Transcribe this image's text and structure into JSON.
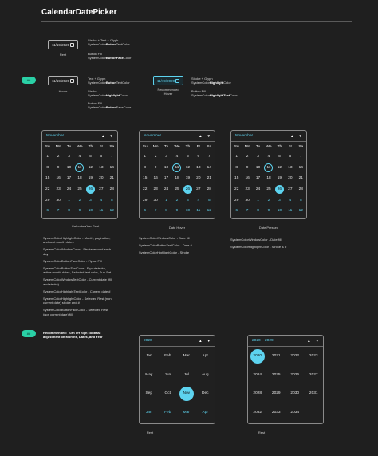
{
  "page_title": "CalendarDatePicker",
  "rest": {
    "date": "11/19/2020",
    "caption": "Rest",
    "desc1a": "Stroke + Text + Glyph",
    "desc1b": "SystemColor",
    "desc1bold": "Button",
    "desc1c": "TextColor",
    "desc2a": "Button Fill",
    "desc2b": "SystemColor",
    "desc2bold": "ButtonFace",
    "desc2c": "Color"
  },
  "hover": {
    "badge": "##",
    "date": "11/19/2020",
    "caption": "Hover",
    "desc1a": "Text + Glyph",
    "desc1b": "SystemColor",
    "desc1bold": "Button",
    "desc1c": "TextColor",
    "desc2a": "Stroke",
    "desc2b": "SystemColor",
    "desc2bold": "Highlight",
    "desc2c": "Color",
    "desc3a": "Button Fill",
    "desc3b": "SystemColor",
    "desc3bold": "Button",
    "desc3c": "FaceColor"
  },
  "rec_hover": {
    "date": "11/19/2020",
    "caption1": "Recommended",
    "caption2": "Hover",
    "desc1a": "Stroke + Glyph",
    "desc1b": "SystemColor",
    "desc1bold": "Highlight",
    "desc1c": "Color",
    "desc2a": "Button Fill",
    "desc2b": "SystemColor",
    "desc2bold": "HighlightText",
    "desc2c": "Color"
  },
  "calendar": {
    "month": "November",
    "up": "▲",
    "down": "▼",
    "weekdays": [
      "Su",
      "Mo",
      "Tu",
      "We",
      "Th",
      "Fr",
      "Sa"
    ],
    "days": [
      "1",
      "2",
      "3",
      "4",
      "5",
      "6",
      "7",
      "8",
      "9",
      "10",
      "11",
      "12",
      "13",
      "14",
      "15",
      "16",
      "17",
      "18",
      "19",
      "20",
      "21",
      "22",
      "23",
      "24",
      "25",
      "26",
      "27",
      "28",
      "29",
      "30",
      "1",
      "2",
      "3",
      "4",
      "5",
      "6",
      "7",
      "8",
      "9",
      "10",
      "11",
      "12"
    ]
  },
  "cal_captions": {
    "rest": "CalendarView Rest",
    "hover": "Date Hover",
    "pressed": "Date Pressed"
  },
  "notes_rest": [
    "SystemColorHighlightColor - Month, pagination, and next month dates",
    "SystemColorWindowColor - Stroke around each day",
    "SystemColorButtonFaceColor - Flyout Fill",
    "SystemColorButtonTextColor - Flyout stroke, active month dates, Selected text color, Sun-Sat",
    "SystemColorWindowTextColor - Current date (fill and stroke)",
    "SystemColorHighlightTextColor - Current date #",
    "SystemColorHighlightColor - Selected Rest (non current date) stroke and #",
    "SystemColorButtonFaceColor - Selected Rest (non current date) fill"
  ],
  "notes_hover": [
    "SystemColorWindowColor - Date fill",
    "SystemColorButtonTextColor - Date #",
    "SystemColorHighlightColor - Stroke"
  ],
  "notes_pressed": [
    "SystemColorWindowColor - Date fill",
    "SystemColorHighlightColor - Stroke & #"
  ],
  "recommend": {
    "badge": "##",
    "text1": "Recommended: Turn off high contrast",
    "text2": "adjustment on Months, Dates, and Year"
  },
  "month_view": {
    "header": "2020",
    "months": [
      "Jan",
      "Feb",
      "Mar",
      "Apr",
      "May",
      "Jun",
      "Jul",
      "Aug",
      "Sep",
      "Oct",
      "Nov",
      "Dec",
      "Jan",
      "Feb",
      "Mar",
      "Apr"
    ],
    "caption": "Rest"
  },
  "year_view": {
    "header": "2020 – 2029",
    "years": [
      "2020",
      "2021",
      "2022",
      "2023",
      "2024",
      "2025",
      "2026",
      "2027",
      "2028",
      "2029",
      "2030",
      "2031",
      "2032",
      "2033",
      "2034"
    ],
    "caption": "Rest"
  },
  "colors": {
    "background": "#1f1f1f",
    "accent": "#5dd3ef",
    "badge": "#2ad0a6",
    "stroke": "#8a8a8a"
  }
}
